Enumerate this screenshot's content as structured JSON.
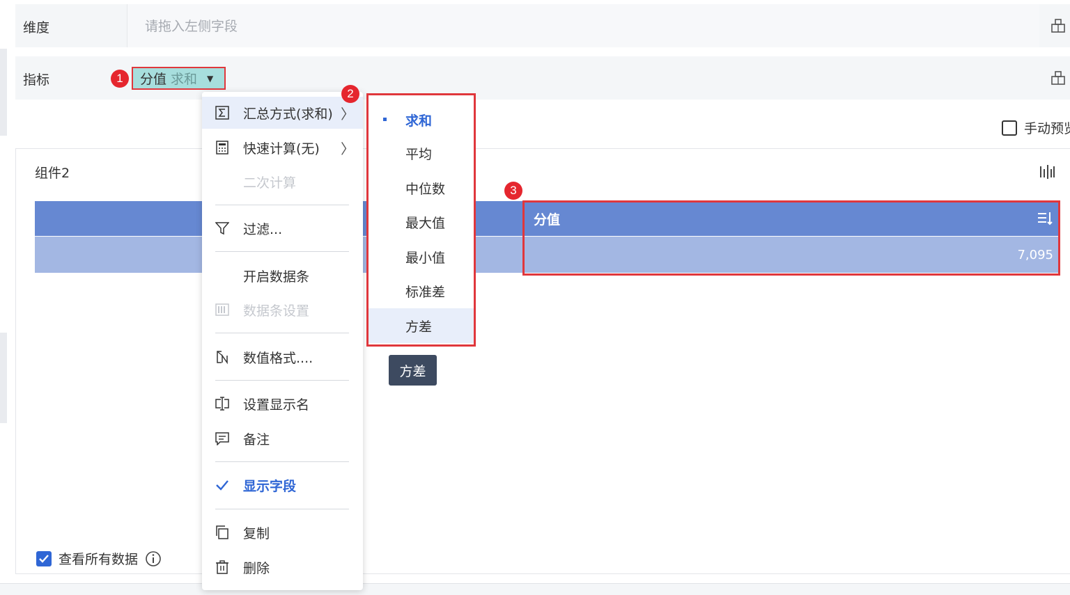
{
  "fields": {
    "dimension_label": "维度",
    "dimension_placeholder": "请拖入左侧字段",
    "measure_label": "指标",
    "measure_pill": {
      "name": "分值",
      "aggregation": "求和"
    }
  },
  "badges": [
    "1",
    "2",
    "3"
  ],
  "manual_preview_label": "手动预览",
  "component": {
    "title": "组件2",
    "table": {
      "column_header": "分值",
      "value": "7,095"
    }
  },
  "context_menu": {
    "items": [
      {
        "label": "汇总方式(求和)",
        "icon": "sigma-icon",
        "has_submenu": true,
        "state": "active"
      },
      {
        "label": "快速计算(无)",
        "icon": "calculator-icon",
        "has_submenu": true,
        "state": "normal"
      },
      {
        "label": "二次计算",
        "icon": "",
        "has_submenu": false,
        "state": "disabled"
      },
      {
        "label": "过滤...",
        "icon": "filter-icon",
        "has_submenu": false,
        "state": "normal"
      },
      {
        "label": "开启数据条",
        "icon": "",
        "has_submenu": false,
        "state": "normal"
      },
      {
        "label": "数据条设置",
        "icon": "databar-icon",
        "has_submenu": false,
        "state": "disabled"
      },
      {
        "label": "数值格式....",
        "icon": "number-format-icon",
        "has_submenu": false,
        "state": "normal"
      },
      {
        "label": "设置显示名",
        "icon": "rename-icon",
        "has_submenu": false,
        "state": "normal"
      },
      {
        "label": "备注",
        "icon": "comment-icon",
        "has_submenu": false,
        "state": "normal"
      },
      {
        "label": "显示字段",
        "icon": "check-icon",
        "has_submenu": false,
        "state": "checked"
      },
      {
        "label": "复制",
        "icon": "copy-icon",
        "has_submenu": false,
        "state": "normal"
      },
      {
        "label": "删除",
        "icon": "trash-icon",
        "has_submenu": false,
        "state": "normal"
      }
    ]
  },
  "aggregation_submenu": {
    "options": [
      "求和",
      "平均",
      "中位数",
      "最大值",
      "最小值",
      "标准差",
      "方差"
    ],
    "selected": "求和",
    "hovered": "方差"
  },
  "tooltip": "方差",
  "view_all_data_label": "查看所有数据",
  "colors": {
    "accent": "#2f66d5",
    "table_header": "#6688d2",
    "table_row": "#a3b7e3",
    "highlight_red": "#e0373c",
    "pill_bg": "#a7dedd",
    "tooltip_bg": "#3d4a60"
  }
}
